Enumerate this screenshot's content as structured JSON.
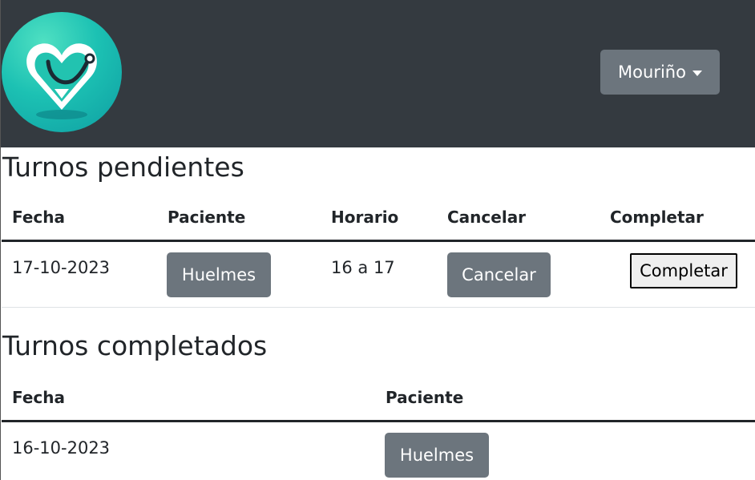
{
  "navbar": {
    "logo_icon": "heart-stethoscope-logo",
    "user_menu_label": "Mouriño"
  },
  "pending": {
    "title": "Turnos pendientes",
    "headers": [
      "Fecha",
      "Paciente",
      "Horario",
      "Cancelar",
      "Completar"
    ],
    "rows": [
      {
        "fecha": "17-10-2023",
        "paciente": "Huelmes",
        "horario": "16 a 17",
        "cancelar": "Cancelar",
        "completar": "Completar"
      }
    ]
  },
  "completed": {
    "title": "Turnos completados",
    "headers": [
      "Fecha",
      "Paciente"
    ],
    "rows": [
      {
        "fecha": "16-10-2023",
        "paciente": "Huelmes"
      }
    ]
  },
  "colors": {
    "navbar_bg": "#343a40",
    "secondary_button": "#6c757d",
    "logo_teal": "#1cc1b3"
  }
}
